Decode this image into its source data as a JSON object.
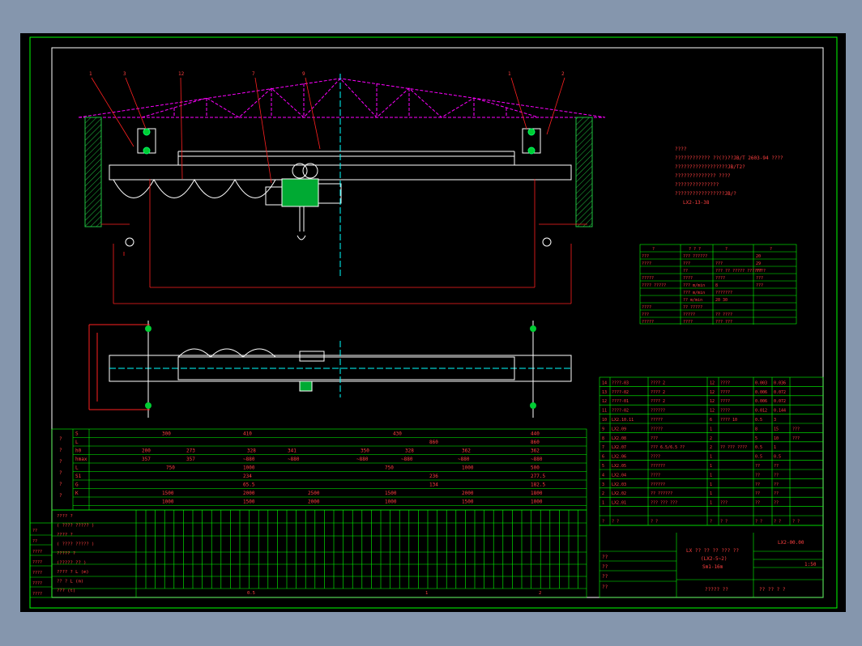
{
  "colors": {
    "viewport_bg": "#8596ad",
    "paper": "#000000",
    "border": "#00ff00",
    "outline": "#ffffff",
    "truss": "#ff00ff",
    "leader": "#ff2020",
    "table_text": "#ff4040",
    "center": "#00ffff",
    "hoist": "#00cc33",
    "wall": "#20c040"
  },
  "notes": {
    "lines": [
      "????",
      "???????????? ??(?)??JB/T 2603-94 ????",
      "??????????????????JB/T2?",
      "?????????????? ????",
      "???????????????",
      "?????????????????JB/?",
      "LX2-13-38"
    ]
  },
  "params": {
    "header": [
      "?",
      "? ?  ?",
      "?",
      "?"
    ],
    "rows": [
      [
        "???",
        "???  ??????",
        "",
        "20"
      ],
      [
        "????",
        "???",
        "???",
        "29"
      ],
      [
        "",
        "??",
        "??? ??  ????? ??????",
        "????"
      ],
      [
        "?????",
        "????",
        "????",
        "???"
      ],
      [
        "???? ?????",
        "??? m/min",
        "8",
        "???"
      ],
      [
        "",
        "??? m/min",
        "???????",
        ""
      ],
      [
        "",
        "?? m/min",
        "20  30",
        ""
      ],
      [
        "????",
        "??  ?????",
        "",
        ""
      ],
      [
        "???",
        "?????",
        "?? ????",
        ""
      ],
      [
        "?????",
        "????",
        "??? ???",
        ""
      ]
    ]
  },
  "bom": {
    "rows": [
      [
        "14",
        "????-03",
        "???? 2",
        "12",
        "????",
        "0.003",
        "0.036",
        ""
      ],
      [
        "13",
        "????-02",
        "???? 2",
        "12",
        "????",
        "0.006",
        "0.072",
        ""
      ],
      [
        "12",
        "????-01",
        "???? 2",
        "12",
        "????",
        "0.006",
        "0.072",
        ""
      ],
      [
        "11",
        "????-02",
        "??????",
        "12",
        "????",
        "0.012",
        "0.144",
        ""
      ],
      [
        "10",
        "LX2.10.11",
        "?????",
        "6",
        "???? 10",
        "0.5",
        "3",
        ""
      ],
      [
        "9",
        "LX2.09",
        "?????",
        "1",
        "",
        "8",
        "15",
        "???"
      ],
      [
        "8",
        "LX2.08",
        "???",
        "2",
        "",
        "5",
        "10",
        "???"
      ],
      [
        "7",
        "LX2.07",
        "??? 6.5/6.5 ??",
        "2",
        "?? ??? ????",
        "0.5",
        "1",
        ""
      ],
      [
        "6",
        "LX2.06",
        "????",
        "1",
        "",
        "0.5",
        "0.5",
        ""
      ],
      [
        "5",
        "LX2.05",
        "??????",
        "1",
        "",
        "??",
        "??",
        ""
      ],
      [
        "4",
        "LX2.04",
        "????",
        "1",
        "",
        "??",
        "??",
        ""
      ],
      [
        "3",
        "LX2.03",
        "??????",
        "1",
        "",
        "??",
        "??",
        ""
      ],
      [
        "2",
        "LX2.02",
        "?? ??????",
        "1",
        "",
        "??",
        "??",
        ""
      ],
      [
        "1",
        "LX2.01",
        "??? ??? ???",
        "1",
        "???",
        "??",
        "??",
        ""
      ]
    ],
    "header": [
      "?",
      "? ?",
      "? ?",
      "?",
      "? ?",
      "? ?",
      "? ?",
      "? ?"
    ]
  },
  "title_block": {
    "drawing_no": "LX2-00.00",
    "title_1": "LX ?? ?? ?? ??? ??",
    "title_2": "(LX2-5~2)",
    "title_3": "Sm1-16m",
    "scale": "1:50",
    "school": "????? ??",
    "sheet_info": "?? ?? ? ?",
    "left_labels": [
      "??",
      "??",
      "??",
      "??"
    ]
  },
  "dims": {
    "side_label": [
      "?",
      "?",
      "?",
      "?",
      "?",
      "?"
    ],
    "col_headers": [
      "S",
      "L",
      "h0",
      "hmax",
      "L",
      "S1",
      "G",
      "K"
    ],
    "row_S": [
      "300",
      "410",
      "430",
      "440"
    ],
    "row_L": [
      "",
      "",
      "860",
      "860"
    ],
    "row_h0": [
      "200",
      "273",
      "328",
      "341",
      "350",
      "328",
      "362",
      "362"
    ],
    "row_hmax": [
      "357",
      "357",
      "~880",
      "~880",
      "~880",
      "~880",
      "~880",
      "~880"
    ],
    "row_l": [
      "750",
      "1000",
      "750",
      "1000",
      "500"
    ],
    "row_s1": [
      "234",
      "236",
      "277.5"
    ],
    "row_g": [
      "65.5",
      "134",
      "182.5"
    ],
    "row_k1": [
      "1500",
      "2000",
      "2500",
      "1500",
      "2000",
      "1800"
    ],
    "row_k2": [
      "1000",
      "1500",
      "2000",
      "1000",
      "1500",
      "1000"
    ]
  },
  "bottom_rows": {
    "labels": [
      "???? ?",
      "( ???? ????? )",
      "???? ?",
      "( ???? ????? )",
      "????? ?",
      "(????? ?? )",
      "???? ? L (m)",
      "?? ? L (m)",
      "??? (t)"
    ],
    "weights": [
      "0.5",
      "1",
      "2"
    ],
    "left_tags": [
      "??",
      "??",
      "????",
      "????",
      "????",
      "????",
      "????"
    ]
  },
  "callouts": [
    "1",
    "3",
    "12",
    "7",
    "9",
    "1",
    "2"
  ]
}
